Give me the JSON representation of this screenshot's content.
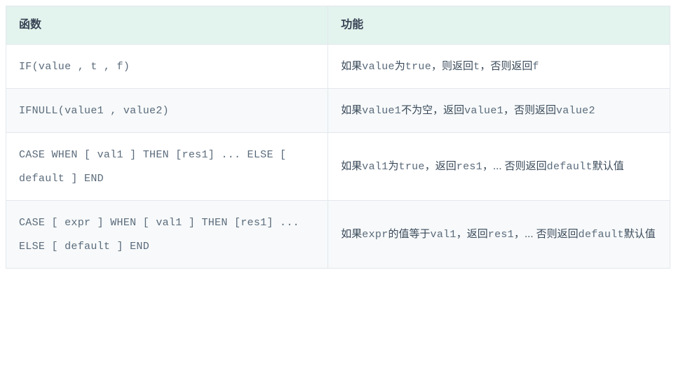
{
  "table": {
    "headers": {
      "col1": "函数",
      "col2": "功能"
    },
    "rows": [
      {
        "func": {
          "parts": [
            "IF(value , t , f)"
          ]
        },
        "desc": {
          "segments": [
            {
              "t": "如果",
              "code": false
            },
            {
              "t": "value",
              "code": true
            },
            {
              "t": "为",
              "code": false
            },
            {
              "t": "true",
              "code": true
            },
            {
              "t": "，则返回",
              "code": false
            },
            {
              "t": "t",
              "code": true
            },
            {
              "t": "，否则返回",
              "code": false
            },
            {
              "t": "f",
              "code": true
            }
          ]
        }
      },
      {
        "func": {
          "parts": [
            "IFNULL(value1 , value2)"
          ]
        },
        "desc": {
          "segments": [
            {
              "t": "如果",
              "code": false
            },
            {
              "t": "value1",
              "code": true
            },
            {
              "t": "不为空，返回",
              "code": false
            },
            {
              "t": "value1",
              "code": true
            },
            {
              "t": "，否则返回",
              "code": false
            },
            {
              "t": "value2",
              "code": true
            }
          ]
        }
      },
      {
        "func": {
          "parts": [
            "CASE WHEN [ val1 ] THEN [res1] ... ELSE [ default ] END"
          ]
        },
        "desc": {
          "segments": [
            {
              "t": "如果",
              "code": false
            },
            {
              "t": "val1",
              "code": true
            },
            {
              "t": "为",
              "code": false
            },
            {
              "t": "true",
              "code": true
            },
            {
              "t": "，返回",
              "code": false
            },
            {
              "t": "res1",
              "code": true
            },
            {
              "t": "，... 否则返回",
              "code": false
            },
            {
              "t": "default",
              "code": true
            },
            {
              "t": "默认值",
              "code": false
            }
          ]
        }
      },
      {
        "func": {
          "parts": [
            "CASE [ expr ] WHEN [ val1 ] THEN [res1] ... ELSE [ default ] END"
          ]
        },
        "desc": {
          "segments": [
            {
              "t": "如果",
              "code": false
            },
            {
              "t": "expr",
              "code": true
            },
            {
              "t": "的值等于",
              "code": false
            },
            {
              "t": "val1",
              "code": true
            },
            {
              "t": "，返回",
              "code": false
            },
            {
              "t": "res1",
              "code": true
            },
            {
              "t": "，... 否则返回",
              "code": false
            },
            {
              "t": "default",
              "code": true
            },
            {
              "t": "默认值",
              "code": false
            }
          ]
        }
      }
    ]
  }
}
